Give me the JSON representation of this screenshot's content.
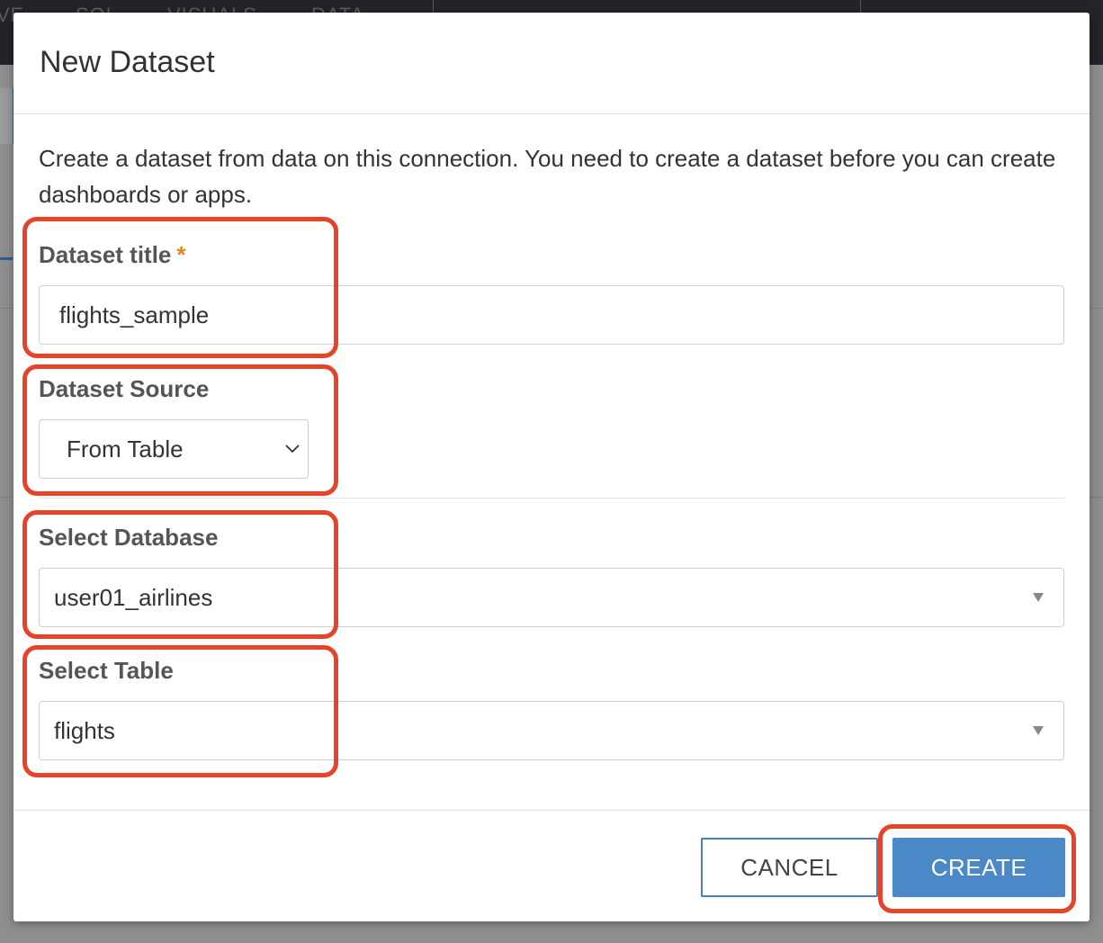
{
  "background": {
    "nav_items": [
      "VE",
      "SQL",
      "VISUALS",
      "DATA"
    ]
  },
  "modal": {
    "title": "New Dataset",
    "intro": "Create a dataset from data on this connection. You need to create a dataset before you can create dashboards or apps.",
    "fields": {
      "dataset_title": {
        "label": "Dataset title",
        "required_mark": "*",
        "value": "flights_sample"
      },
      "dataset_source": {
        "label": "Dataset Source",
        "value": "From Table"
      },
      "select_database": {
        "label": "Select Database",
        "value": "user01_airlines"
      },
      "select_table": {
        "label": "Select Table",
        "value": "flights"
      }
    },
    "buttons": {
      "cancel": "CANCEL",
      "create": "CREATE"
    }
  },
  "colors": {
    "primary_button": "#4a88c7",
    "highlight": "#e5432a",
    "required": "#e8851f"
  }
}
